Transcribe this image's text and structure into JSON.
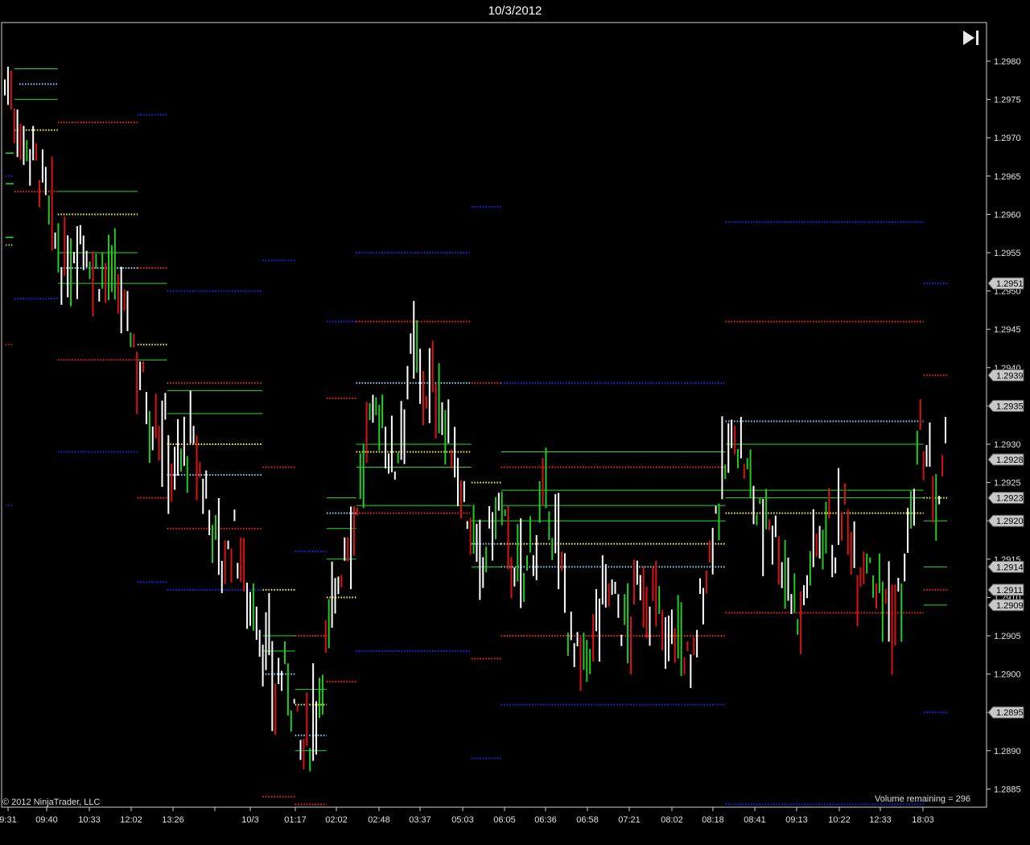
{
  "window": {
    "title": "10/3/2012"
  },
  "footer": {
    "copyright": "© 2012 NinjaTrader, LLC",
    "volume_remaining": "Volume remaining = 296"
  },
  "colors": {
    "background": "#000000",
    "up_bar": "#22cc22",
    "down_bar": "#dd1111",
    "neutral_bar": "#ffffff",
    "level_green": "#22dd22",
    "level_red": "#ff2222",
    "level_blue": "#2222ff",
    "level_cyan": "#88ddff",
    "level_yellow": "#ffff44",
    "price_marker": "#c8c8c8"
  },
  "chart_data": {
    "type": "bar",
    "subtype": "ohlc-volume-bars",
    "ylim": [
      1.2883,
      1.2985
    ],
    "grid": false,
    "y_ticks": [
      "1.2980",
      "1.2975",
      "1.2970",
      "1.2965",
      "1.2960",
      "1.2955",
      "1.2950",
      "1.2945",
      "1.2940",
      "1.2935",
      "1.2930",
      "1.2925",
      "1.2920",
      "1.2915",
      "1.2910",
      "1.2905",
      "1.2900",
      "1.2895",
      "1.2890",
      "1.2885"
    ],
    "x_ticks": [
      "9:31",
      "09:40",
      "10:33",
      "12:02",
      "13:26",
      "10/3",
      "01:17",
      "02:02",
      "02:48",
      "03:37",
      "05:03",
      "06:05",
      "06:36",
      "06:58",
      "07:21",
      "08:02",
      "08:18",
      "08:41",
      "09:13",
      "10:22",
      "12:33",
      "18:03"
    ],
    "price_markers": [
      "1.2951",
      "1.2939",
      "1.2935",
      "1.2928",
      "1.2923",
      "1.2920",
      "1.2914",
      "1.2911",
      "1.2909",
      "1.2895"
    ],
    "close_path": [
      1.2977,
      1.2975,
      1.297,
      1.2969,
      1.2966,
      1.2961,
      1.2956,
      1.2952,
      1.2955,
      1.2958,
      1.2954,
      1.2952,
      1.2953,
      1.295,
      1.2948,
      1.2944,
      1.294,
      1.2934,
      1.2933,
      1.2931,
      1.2926,
      1.2929,
      1.293,
      1.2926,
      1.2922,
      1.2918,
      1.2914,
      1.2918,
      1.2914,
      1.291,
      1.2906,
      1.2902,
      1.2898,
      1.29,
      1.2897,
      1.2889,
      1.2892,
      1.2898,
      1.2905,
      1.291,
      1.2916,
      1.292,
      1.2925,
      1.2932,
      1.2935,
      1.2931,
      1.2927,
      1.2935,
      1.2942,
      1.294,
      1.2936,
      1.2938,
      1.2932,
      1.2928,
      1.2924,
      1.2918,
      1.2913,
      1.2917,
      1.2922,
      1.2919,
      1.2914,
      1.2912,
      1.2916,
      1.292,
      1.2922,
      1.2918,
      1.2911,
      1.2904,
      1.29,
      1.2903,
      1.2908,
      1.2912,
      1.291,
      1.2905,
      1.2908,
      1.2912,
      1.291,
      1.2908,
      1.2905,
      1.2907,
      1.2903,
      1.29,
      1.2908,
      1.2915,
      1.2922,
      1.2926,
      1.2932,
      1.2928,
      1.2924,
      1.292,
      1.2922,
      1.2918,
      1.2914,
      1.291,
      1.2908,
      1.2914,
      1.2918,
      1.2922,
      1.2916,
      1.2921,
      1.2918,
      1.2914,
      1.2916,
      1.2912,
      1.291,
      1.2907,
      1.2912,
      1.292,
      1.293,
      1.2926,
      1.2921,
      1.2928
    ],
    "levels": [
      {
        "c": "green",
        "y": 1.2979,
        "x1": 0.013,
        "x2": 0.057,
        "dot": false
      },
      {
        "c": "cyan",
        "y": 1.2977,
        "x1": 0.018,
        "x2": 0.057,
        "dot": true
      },
      {
        "c": "green",
        "y": 1.2975,
        "x1": 0.013,
        "x2": 0.057,
        "dot": false
      },
      {
        "c": "red",
        "y": 1.2972,
        "x1": 0.057,
        "x2": 0.138,
        "dot": true
      },
      {
        "c": "yellow",
        "y": 1.2971,
        "x1": 0.013,
        "x2": 0.057,
        "dot": true
      },
      {
        "c": "blue",
        "y": 1.2973,
        "x1": 0.138,
        "x2": 0.168,
        "dot": true
      },
      {
        "c": "red",
        "y": 1.2963,
        "x1": 0.013,
        "x2": 0.057,
        "dot": true
      },
      {
        "c": "green",
        "y": 1.2963,
        "x1": 0.057,
        "x2": 0.138,
        "dot": false
      },
      {
        "c": "yellow",
        "y": 1.296,
        "x1": 0.057,
        "x2": 0.138,
        "dot": true
      },
      {
        "c": "green",
        "y": 1.2955,
        "x1": 0.057,
        "x2": 0.138,
        "dot": false
      },
      {
        "c": "cyan",
        "y": 1.2953,
        "x1": 0.057,
        "x2": 0.138,
        "dot": true
      },
      {
        "c": "red",
        "y": 1.2953,
        "x1": 0.138,
        "x2": 0.168,
        "dot": true
      },
      {
        "c": "green",
        "y": 1.2951,
        "x1": 0.057,
        "x2": 0.168,
        "dot": false
      },
      {
        "c": "blue",
        "y": 1.295,
        "x1": 0.168,
        "x2": 0.265,
        "dot": true
      },
      {
        "c": "blue",
        "y": 1.2949,
        "x1": 0.013,
        "x2": 0.057,
        "dot": true
      },
      {
        "c": "blue",
        "y": 1.2954,
        "x1": 0.265,
        "x2": 0.298,
        "dot": true
      },
      {
        "c": "red",
        "y": 1.2941,
        "x1": 0.057,
        "x2": 0.138,
        "dot": true
      },
      {
        "c": "yellow",
        "y": 1.2943,
        "x1": 0.138,
        "x2": 0.168,
        "dot": true
      },
      {
        "c": "green",
        "y": 1.2941,
        "x1": 0.138,
        "x2": 0.168,
        "dot": false
      },
      {
        "c": "red",
        "y": 1.2938,
        "x1": 0.168,
        "x2": 0.265,
        "dot": true
      },
      {
        "c": "green",
        "y": 1.2937,
        "x1": 0.168,
        "x2": 0.265,
        "dot": false
      },
      {
        "c": "green",
        "y": 1.2934,
        "x1": 0.168,
        "x2": 0.265,
        "dot": false
      },
      {
        "c": "yellow",
        "y": 1.293,
        "x1": 0.168,
        "x2": 0.265,
        "dot": true
      },
      {
        "c": "blue",
        "y": 1.2929,
        "x1": 0.057,
        "x2": 0.138,
        "dot": true
      },
      {
        "c": "cyan",
        "y": 1.2926,
        "x1": 0.168,
        "x2": 0.265,
        "dot": true
      },
      {
        "c": "red",
        "y": 1.2927,
        "x1": 0.265,
        "x2": 0.298,
        "dot": true
      },
      {
        "c": "red",
        "y": 1.2923,
        "x1": 0.138,
        "x2": 0.168,
        "dot": true
      },
      {
        "c": "red",
        "y": 1.2919,
        "x1": 0.168,
        "x2": 0.265,
        "dot": true
      },
      {
        "c": "blue",
        "y": 1.2912,
        "x1": 0.138,
        "x2": 0.168,
        "dot": true
      },
      {
        "c": "blue",
        "y": 1.2911,
        "x1": 0.168,
        "x2": 0.265,
        "dot": true
      },
      {
        "c": "yellow",
        "y": 1.2911,
        "x1": 0.265,
        "x2": 0.298,
        "dot": true
      },
      {
        "c": "green",
        "y": 1.2905,
        "x1": 0.265,
        "x2": 0.298,
        "dot": false
      },
      {
        "c": "red",
        "y": 1.2905,
        "x1": 0.298,
        "x2": 0.33,
        "dot": true
      },
      {
        "c": "green",
        "y": 1.2903,
        "x1": 0.265,
        "x2": 0.298,
        "dot": false
      },
      {
        "c": "cyan",
        "y": 1.29,
        "x1": 0.265,
        "x2": 0.298,
        "dot": true
      },
      {
        "c": "green",
        "y": 1.2898,
        "x1": 0.298,
        "x2": 0.33,
        "dot": false
      },
      {
        "c": "yellow",
        "y": 1.2896,
        "x1": 0.298,
        "x2": 0.33,
        "dot": true
      },
      {
        "c": "cyan",
        "y": 1.2892,
        "x1": 0.298,
        "x2": 0.33,
        "dot": true
      },
      {
        "c": "green",
        "y": 1.289,
        "x1": 0.298,
        "x2": 0.33,
        "dot": false
      },
      {
        "c": "red",
        "y": 1.2884,
        "x1": 0.265,
        "x2": 0.298,
        "dot": true
      },
      {
        "c": "red",
        "y": 1.2883,
        "x1": 0.298,
        "x2": 0.33,
        "dot": true
      },
      {
        "c": "blue",
        "y": 1.2916,
        "x1": 0.298,
        "x2": 0.33,
        "dot": true
      },
      {
        "c": "blue",
        "y": 1.2946,
        "x1": 0.33,
        "x2": 0.36,
        "dot": true
      },
      {
        "c": "red",
        "y": 1.2936,
        "x1": 0.33,
        "x2": 0.36,
        "dot": true
      },
      {
        "c": "green",
        "y": 1.2923,
        "x1": 0.33,
        "x2": 0.36,
        "dot": false
      },
      {
        "c": "cyan",
        "y": 1.2921,
        "x1": 0.33,
        "x2": 0.36,
        "dot": true
      },
      {
        "c": "green",
        "y": 1.2919,
        "x1": 0.33,
        "x2": 0.36,
        "dot": false
      },
      {
        "c": "green",
        "y": 1.2915,
        "x1": 0.33,
        "x2": 0.36,
        "dot": false
      },
      {
        "c": "yellow",
        "y": 1.291,
        "x1": 0.33,
        "x2": 0.36,
        "dot": true
      },
      {
        "c": "red",
        "y": 1.2899,
        "x1": 0.33,
        "x2": 0.36,
        "dot": true
      },
      {
        "c": "blue",
        "y": 1.2955,
        "x1": 0.36,
        "x2": 0.477,
        "dot": true
      },
      {
        "c": "red",
        "y": 1.2946,
        "x1": 0.36,
        "x2": 0.477,
        "dot": true
      },
      {
        "c": "cyan",
        "y": 1.2938,
        "x1": 0.36,
        "x2": 0.477,
        "dot": true
      },
      {
        "c": "green",
        "y": 1.293,
        "x1": 0.36,
        "x2": 0.477,
        "dot": false
      },
      {
        "c": "yellow",
        "y": 1.2929,
        "x1": 0.36,
        "x2": 0.477,
        "dot": true
      },
      {
        "c": "green",
        "y": 1.2927,
        "x1": 0.36,
        "x2": 0.477,
        "dot": false
      },
      {
        "c": "green",
        "y": 1.2922,
        "x1": 0.36,
        "x2": 0.477,
        "dot": false
      },
      {
        "c": "red",
        "y": 1.2921,
        "x1": 0.36,
        "x2": 0.477,
        "dot": true
      },
      {
        "c": "blue",
        "y": 1.2903,
        "x1": 0.36,
        "x2": 0.477,
        "dot": true
      },
      {
        "c": "blue",
        "y": 1.2961,
        "x1": 0.477,
        "x2": 0.507,
        "dot": true
      },
      {
        "c": "red",
        "y": 1.2938,
        "x1": 0.477,
        "x2": 0.507,
        "dot": true
      },
      {
        "c": "yellow",
        "y": 1.2925,
        "x1": 0.477,
        "x2": 0.507,
        "dot": true
      },
      {
        "c": "green",
        "y": 1.292,
        "x1": 0.477,
        "x2": 0.507,
        "dot": false
      },
      {
        "c": "cyan",
        "y": 1.2917,
        "x1": 0.477,
        "x2": 0.507,
        "dot": true
      },
      {
        "c": "green",
        "y": 1.2914,
        "x1": 0.477,
        "x2": 0.507,
        "dot": false
      },
      {
        "c": "red",
        "y": 1.2902,
        "x1": 0.477,
        "x2": 0.507,
        "dot": true
      },
      {
        "c": "blue",
        "y": 1.2889,
        "x1": 0.477,
        "x2": 0.507,
        "dot": true
      },
      {
        "c": "blue",
        "y": 1.2938,
        "x1": 0.507,
        "x2": 0.735,
        "dot": true
      },
      {
        "c": "green",
        "y": 1.2929,
        "x1": 0.507,
        "x2": 0.735,
        "dot": false
      },
      {
        "c": "red",
        "y": 1.2927,
        "x1": 0.507,
        "x2": 0.735,
        "dot": true
      },
      {
        "c": "green",
        "y": 1.2924,
        "x1": 0.507,
        "x2": 0.735,
        "dot": false
      },
      {
        "c": "green",
        "y": 1.2922,
        "x1": 0.507,
        "x2": 0.735,
        "dot": false
      },
      {
        "c": "green",
        "y": 1.292,
        "x1": 0.507,
        "x2": 0.735,
        "dot": false
      },
      {
        "c": "yellow",
        "y": 1.2917,
        "x1": 0.507,
        "x2": 0.735,
        "dot": true
      },
      {
        "c": "cyan",
        "y": 1.2914,
        "x1": 0.507,
        "x2": 0.735,
        "dot": true
      },
      {
        "c": "red",
        "y": 1.2905,
        "x1": 0.507,
        "x2": 0.735,
        "dot": true
      },
      {
        "c": "blue",
        "y": 1.2896,
        "x1": 0.507,
        "x2": 0.735,
        "dot": true
      },
      {
        "c": "blue",
        "y": 1.2959,
        "x1": 0.735,
        "x2": 0.936,
        "dot": true
      },
      {
        "c": "red",
        "y": 1.2946,
        "x1": 0.735,
        "x2": 0.936,
        "dot": true
      },
      {
        "c": "cyan",
        "y": 1.2933,
        "x1": 0.735,
        "x2": 0.936,
        "dot": true
      },
      {
        "c": "green",
        "y": 1.293,
        "x1": 0.735,
        "x2": 0.936,
        "dot": false
      },
      {
        "c": "green",
        "y": 1.2924,
        "x1": 0.735,
        "x2": 0.936,
        "dot": false
      },
      {
        "c": "green",
        "y": 1.2923,
        "x1": 0.735,
        "x2": 0.936,
        "dot": false
      },
      {
        "c": "yellow",
        "y": 1.2921,
        "x1": 0.735,
        "x2": 0.936,
        "dot": true
      },
      {
        "c": "red",
        "y": 1.2908,
        "x1": 0.735,
        "x2": 0.936,
        "dot": true
      },
      {
        "c": "blue",
        "y": 1.2883,
        "x1": 0.735,
        "x2": 0.936,
        "dot": true
      },
      {
        "c": "blue",
        "y": 1.2951,
        "x1": 0.936,
        "x2": 0.96,
        "dot": true
      },
      {
        "c": "red",
        "y": 1.2939,
        "x1": 0.936,
        "x2": 0.96,
        "dot": true
      },
      {
        "c": "yellow",
        "y": 1.2923,
        "x1": 0.936,
        "x2": 0.96,
        "dot": true
      },
      {
        "c": "green",
        "y": 1.292,
        "x1": 0.936,
        "x2": 0.96,
        "dot": false
      },
      {
        "c": "green",
        "y": 1.2914,
        "x1": 0.936,
        "x2": 0.96,
        "dot": false
      },
      {
        "c": "red",
        "y": 1.2911,
        "x1": 0.936,
        "x2": 0.96,
        "dot": true
      },
      {
        "c": "green",
        "y": 1.2909,
        "x1": 0.936,
        "x2": 0.96,
        "dot": false
      },
      {
        "c": "blue",
        "y": 1.2895,
        "x1": 0.936,
        "x2": 0.96,
        "dot": true
      }
    ]
  }
}
